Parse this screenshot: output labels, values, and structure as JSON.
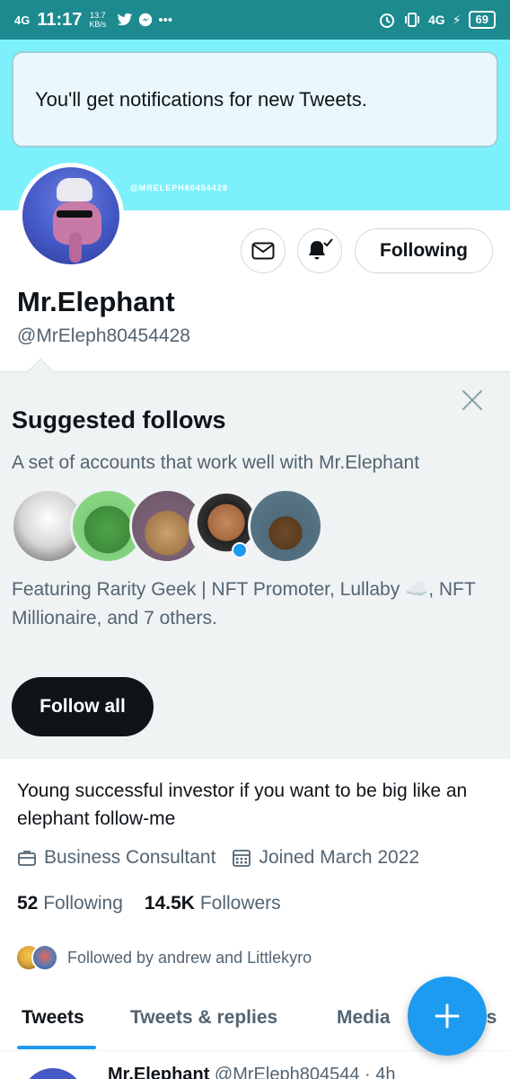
{
  "status_bar": {
    "network": "4G",
    "time": "11:17",
    "speed_value": "13.7",
    "speed_unit": "KB/s",
    "right_network": "4G",
    "battery": "69"
  },
  "toast": {
    "message": "You'll get notifications for new Tweets."
  },
  "banner": {
    "watermark": "@MRELEPH80454428"
  },
  "profile": {
    "name": "Mr.Elephant",
    "handle": "@MrEleph80454428",
    "following_button": "Following",
    "bio": "Young successful investor if you want to be big like an elephant follow-me",
    "category": "Business Consultant",
    "joined": "Joined March 2022",
    "following_count": "52",
    "following_label": "Following",
    "followers_count": "14.5K",
    "followers_label": "Followers",
    "followed_by": "Followed by andrew and Littlekyro"
  },
  "suggested": {
    "title": "Suggested follows",
    "subtitle": "A set of accounts that work well with Mr.Elephant",
    "featuring": "Featuring Rarity Geek | NFT Promoter, Lullaby ☁️, NFT Millionaire, and 7 others.",
    "follow_all": "Follow all"
  },
  "tabs": {
    "tweets": "Tweets",
    "replies": "Tweets & replies",
    "media": "Media",
    "likes": "es"
  },
  "tweet_preview": {
    "name": "Mr.Elephant",
    "handle": "@MrEleph804544",
    "time": "· 4h"
  },
  "colors": {
    "accent": "#1d9bf0",
    "status_bar": "#1c8a8f",
    "banner": "#7df1fb",
    "suggest_bg": "#eff3f4"
  }
}
